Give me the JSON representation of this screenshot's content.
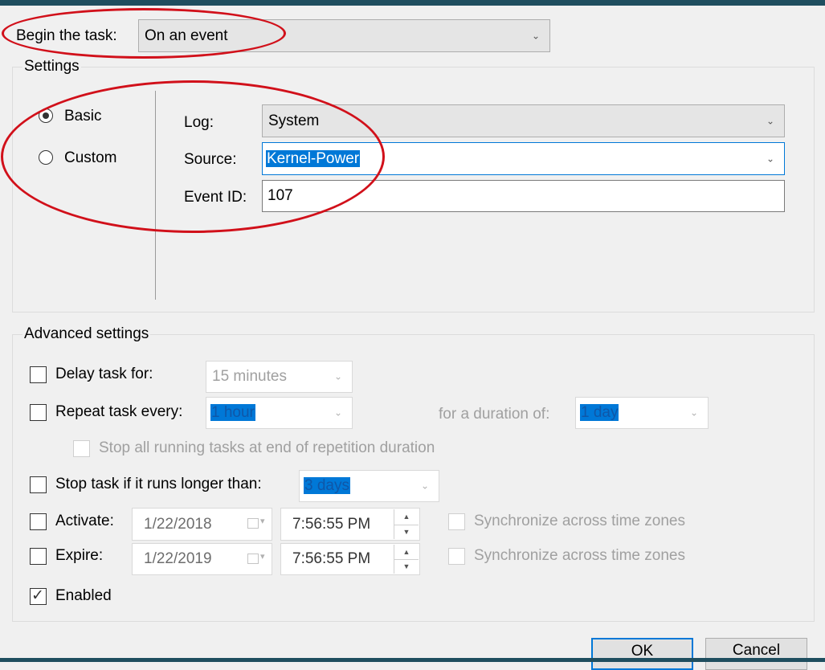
{
  "trigger": {
    "begin_label": "Begin the task:",
    "begin_value": "On an event"
  },
  "settings": {
    "title": "Settings",
    "mode_basic": "Basic",
    "mode_custom": "Custom",
    "selected_mode": "Basic",
    "log_label": "Log:",
    "log_value": "System",
    "source_label": "Source:",
    "source_value": "Kernel-Power",
    "event_id_label": "Event ID:",
    "event_id_value": "107"
  },
  "advanced": {
    "title": "Advanced settings",
    "delay_label": "Delay task for:",
    "delay_value": "15 minutes",
    "delay_checked": false,
    "repeat_label": "Repeat task every:",
    "repeat_value": "1 hour",
    "repeat_checked": false,
    "duration_label": "for a duration of:",
    "duration_value": "1 day",
    "stop_all_label": "Stop all running tasks at end of repetition duration",
    "stop_all_checked": false,
    "stop_longer_label": "Stop task if it runs longer than:",
    "stop_longer_value": "3 days",
    "stop_longer_checked": false,
    "activate_label": "Activate:",
    "activate_date": "1/22/2018",
    "activate_time": "7:56:55 PM",
    "activate_checked": false,
    "activate_sync_label": "Synchronize across time zones",
    "expire_label": "Expire:",
    "expire_date": "1/22/2019",
    "expire_time": "7:56:55 PM",
    "expire_checked": false,
    "expire_sync_label": "Synchronize across time zones",
    "enabled_label": "Enabled",
    "enabled_checked": true
  },
  "buttons": {
    "ok": "OK",
    "cancel": "Cancel"
  },
  "colors": {
    "annotation": "#d1101a",
    "selection": "#0078d7",
    "title_bar": "#1f4e5f"
  },
  "icons": {
    "dropdown": "chevron-down-icon",
    "calendar": "calendar-icon",
    "spin": "spin-arrows-icon",
    "check": "checkmark-icon"
  }
}
